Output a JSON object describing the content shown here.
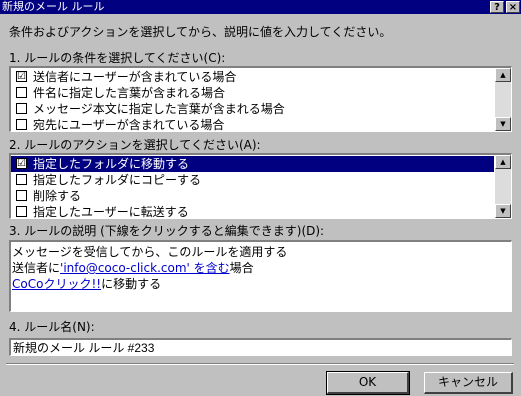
{
  "window": {
    "title": "新規のメール ルール",
    "help_label": "?",
    "close_label": "×"
  },
  "instructions": "条件およびアクションを選択してから、説明に値を入力してください。",
  "step1": {
    "label": "1. ルールの条件を選択してください(C):",
    "items": [
      {
        "label": "送信者にユーザーが含まれている場合",
        "checked": "☑"
      },
      {
        "label": "件名に指定した言葉が含まれる場合",
        "checked": ""
      },
      {
        "label": "メッセージ本文に指定した言葉が含まれる場合",
        "checked": ""
      },
      {
        "label": "宛先にユーザーが含まれている場合",
        "checked": ""
      }
    ]
  },
  "step2": {
    "label": "2. ルールのアクションを選択してください(A):",
    "items": [
      {
        "label": "指定したフォルダに移動する",
        "checked": "☑"
      },
      {
        "label": "指定したフォルダにコピーする",
        "checked": ""
      },
      {
        "label": "削除する",
        "checked": ""
      },
      {
        "label": "指定したユーザーに転送する",
        "checked": ""
      }
    ]
  },
  "step3": {
    "label": "3. ルールの説明 (下線をクリックすると編集できます)(D):",
    "line1": "メッセージを受信してから、このルールを適用する",
    "line2_prefix": "送信者に",
    "line2_link": "'info@coco-click.com' を含む",
    "line2_suffix": "場合",
    "line3_link": "CoCoクリック!!",
    "line3_suffix": "に移動する"
  },
  "step4": {
    "label": "4. ルール名(N):",
    "value": "新規のメール ルール #233"
  },
  "buttons": {
    "ok": "OK",
    "cancel": "キャンセル"
  },
  "scroll_up": "▲",
  "scroll_down": "▼"
}
